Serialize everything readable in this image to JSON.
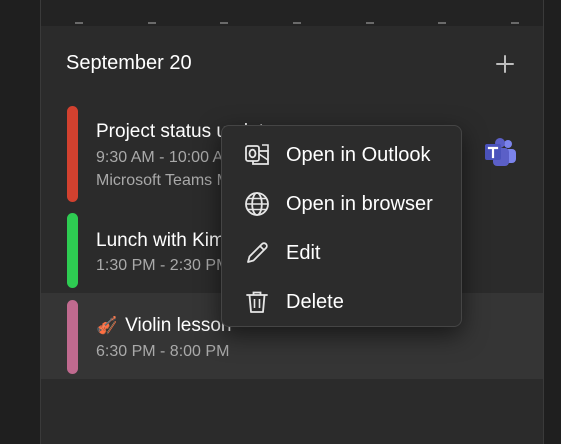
{
  "day_heading": "September 20",
  "events": [
    {
      "title": "Project status update",
      "time": "9:30 AM - 10:00 AM",
      "location": "Microsoft Teams Meeting",
      "color": "#d2412f",
      "icon": "microsoft-teams-icon"
    },
    {
      "title": "Lunch with Kim",
      "time": "1:30 PM - 2:30 PM",
      "color": "#2ecc52"
    },
    {
      "title": "Violin lesson",
      "emoji": "🎻",
      "time": "6:30 PM - 8:00 PM",
      "color": "#c06a8f"
    }
  ],
  "context_menu": {
    "items": [
      {
        "label": "Open in Outlook",
        "icon": "outlook-icon"
      },
      {
        "label": "Open in browser",
        "icon": "globe-icon"
      },
      {
        "label": "Edit",
        "icon": "pencil-icon"
      },
      {
        "label": "Delete",
        "icon": "trash-icon"
      }
    ]
  },
  "colors": {
    "panel_bg": "#2b2b2b",
    "menu_bg": "#2c2c2c",
    "teams_purple": "#5b5fc7"
  }
}
